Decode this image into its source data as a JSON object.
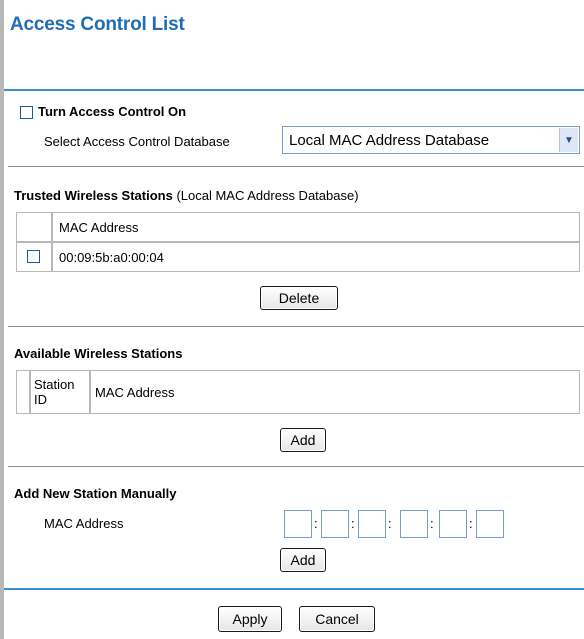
{
  "page": {
    "title": "Access Control List"
  },
  "access_control": {
    "turn_on_label": "Turn Access Control On",
    "select_db_label": "Select Access Control Database",
    "db_selected": "Local MAC Address Database"
  },
  "trusted": {
    "heading": "Trusted Wireless Stations",
    "heading_sub": "(Local MAC Address Database)",
    "col_mac": "MAC Address",
    "rows": [
      {
        "mac": "00:09:5b:a0:00:04"
      }
    ],
    "delete_label": "Delete"
  },
  "available": {
    "heading": "Available Wireless Stations",
    "col_station": "Station ID",
    "col_mac": "MAC Address",
    "add_label": "Add"
  },
  "manual": {
    "heading": "Add New Station Manually",
    "mac_label": "MAC Address",
    "colon": ":",
    "add_label": "Add"
  },
  "footer": {
    "apply_label": "Apply",
    "cancel_label": "Cancel"
  }
}
